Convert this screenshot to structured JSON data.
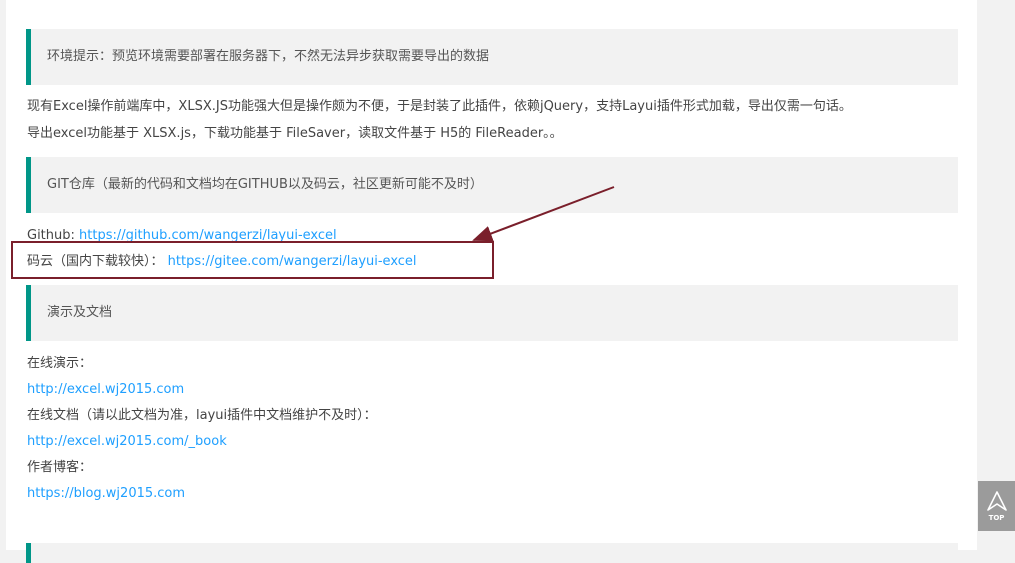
{
  "notes": {
    "env_tip": "环境提示：预览环境需要部署在服务器下，不然无法异步获取需要导出的数据"
  },
  "intro": {
    "line1": "现有Excel操作前端库中，XLSX.JS功能强大但是操作颇为不便，于是封装了此插件，依赖jQuery，支持Layui插件形式加载，导出仅需一句话。",
    "line2": "导出excel功能基于 XLSX.js，下载功能基于 FileSaver，读取文件基于 H5的 FileReader。。"
  },
  "git": {
    "heading": "GIT仓库（最新的代码和文档均在GITHUB以及码云，社区更新可能不及时）",
    "github_label": "Github: ",
    "github_url": "https://github.com/wangerzi/layui-excel",
    "gitee_label": "码云（国内下载较快）：",
    "gitee_url": "https://gitee.com/wangerzi/layui-excel"
  },
  "docs": {
    "heading": "演示及文档",
    "demo_label": "在线演示：",
    "demo_url": "http://excel.wj2015.com",
    "doc_label": "在线文档（请以此文档为准，layui插件中文档维护不及时）：",
    "doc_url": "http://excel.wj2015.com/_book",
    "blog_label": "作者博客：",
    "blog_url": "https://blog.wj2015.com"
  },
  "colors": {
    "accent": "#009688",
    "link": "#1e9fff",
    "highlight_box": "#7a1f2b"
  },
  "top_button": {
    "label": "TOP",
    "icon": "arrow-up-icon"
  }
}
